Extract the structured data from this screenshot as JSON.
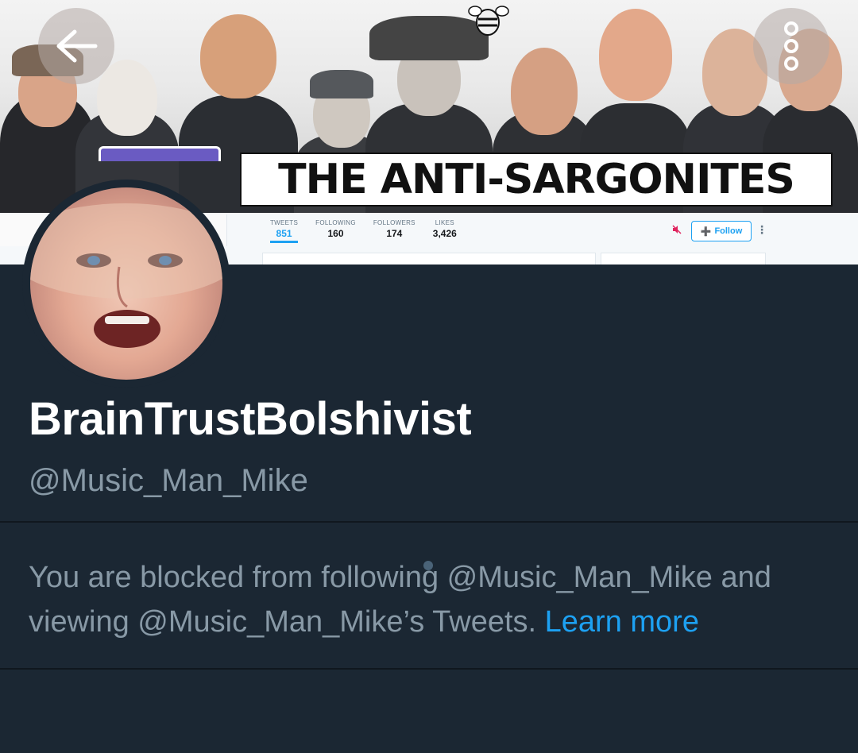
{
  "banner": {
    "title": "THE ANTI-SARGONITES",
    "mini_profile": {
      "stats": [
        {
          "label": "TWEETS",
          "value": "851"
        },
        {
          "label": "FOLLOWING",
          "value": "160"
        },
        {
          "label": "FOLLOWERS",
          "value": "174"
        },
        {
          "label": "LIKES",
          "value": "3,426"
        }
      ],
      "follow_label": "Follow",
      "more_label": "⋮"
    }
  },
  "toolbar": {
    "back_icon": "arrow-left-icon",
    "menu_icon": "vertical-dots-icon"
  },
  "profile": {
    "display_name": "BrainTrustBolshivist",
    "handle": "@Music_Man_Mike",
    "blocked_message": "You are blocked from following @Music_Man_Mike and viewing @Music_Man_Mike’s Tweets. ",
    "learn_more_label": "Learn more"
  },
  "colors": {
    "background": "#1b2733",
    "secondary_text": "#8899a6",
    "accent": "#1da1f2",
    "primary_text": "#ffffff"
  }
}
